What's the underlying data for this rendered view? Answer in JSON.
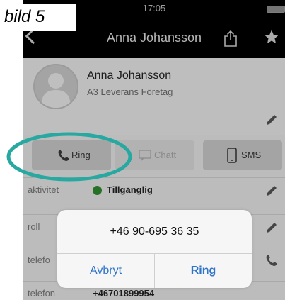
{
  "status_bar": {
    "time": "17:05"
  },
  "nav": {
    "title": "Anna Johansson",
    "back_icon": "chevron-left-icon",
    "share_icon": "share-icon",
    "star_icon": "star-icon"
  },
  "contact": {
    "name": "Anna Johansson",
    "company": "A3 Leverans Företag"
  },
  "actions": {
    "ring_label": "Ring",
    "chatt_label": "Chatt",
    "sms_label": "SMS"
  },
  "rows": [
    {
      "label": "aktivitet",
      "value": "Tillgänglig",
      "status_color": "#2f8a2f"
    },
    {
      "label": "roll",
      "value": ""
    },
    {
      "label": "telefo",
      "value": ""
    },
    {
      "label": "telefon",
      "value": "+46701899954"
    }
  ],
  "dialog": {
    "phone": "+46 90-695 36 35",
    "cancel_label": "Avbryt",
    "confirm_label": "Ring"
  },
  "annotation": {
    "label": "bild 5",
    "highlight_color": "#27a8a0"
  },
  "colors": {
    "accent_blue": "#2f74c9",
    "nav_bg": "#000000",
    "status_green": "#2f8a2f"
  }
}
